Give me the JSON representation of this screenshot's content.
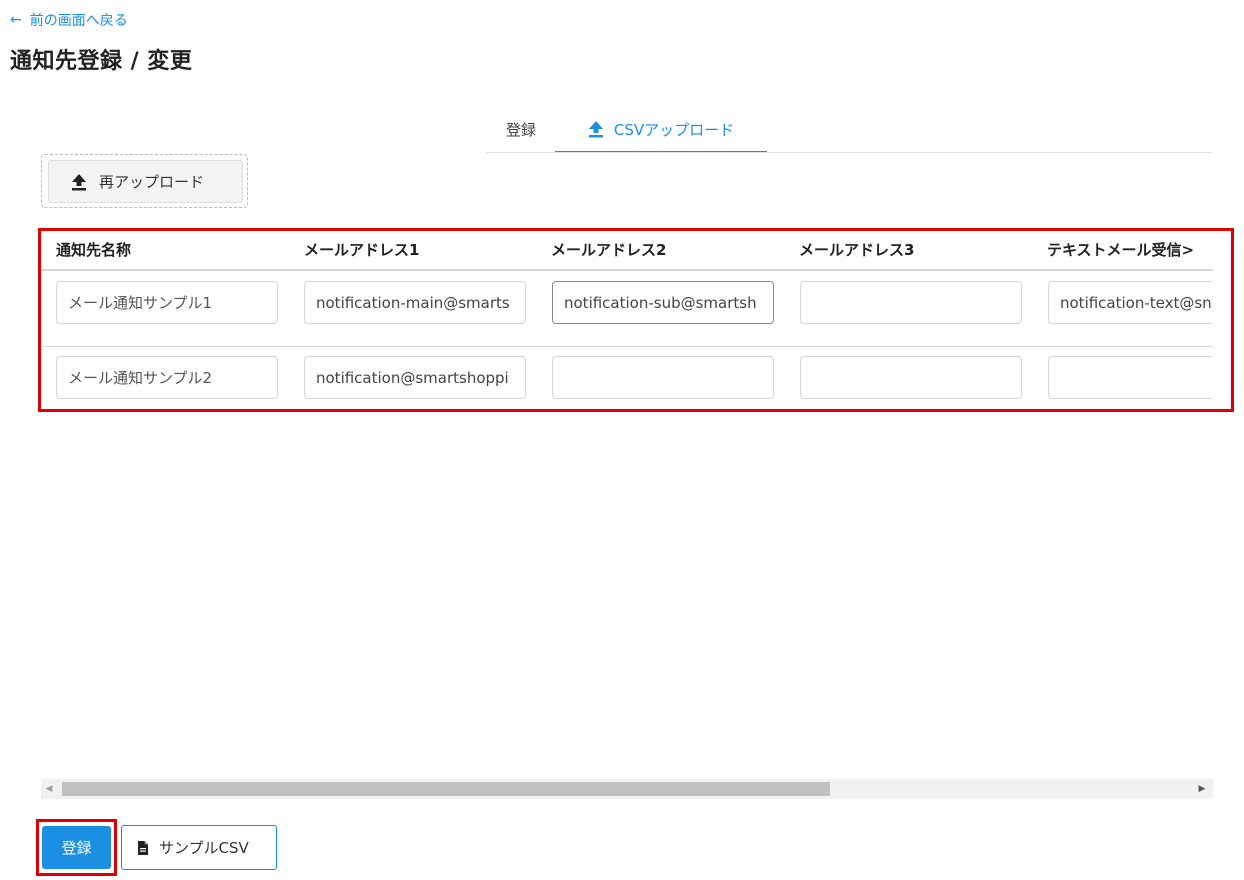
{
  "back_link": {
    "label": "前の画面へ戻る"
  },
  "page_title": "通知先登録 / 変更",
  "tabs": [
    {
      "label": "登録",
      "active": false
    },
    {
      "label": "CSVアップロード",
      "active": true,
      "icon": "upload-icon"
    }
  ],
  "reupload_button": {
    "label": "再アップロード",
    "icon": "upload-icon"
  },
  "table": {
    "columns": [
      "通知先名称",
      "メールアドレス1",
      "メールアドレス2",
      "メールアドレス3",
      "テキストメール受信>"
    ],
    "rows": [
      [
        "メール通知サンプル1",
        "notification-main@smarts",
        "notification-sub@smartsh",
        "",
        "notification-text@sn"
      ],
      [
        "メール通知サンプル2",
        "notification@smartshoppi",
        "",
        "",
        ""
      ]
    ]
  },
  "scrollbar": {
    "thumb_fraction": 0.66
  },
  "buttons": {
    "register": "登録",
    "sample_csv": "サンプルCSV",
    "sample_icon": "file-icon"
  },
  "colors": {
    "accent": "#1a8fe3",
    "highlight": "#e00000"
  }
}
